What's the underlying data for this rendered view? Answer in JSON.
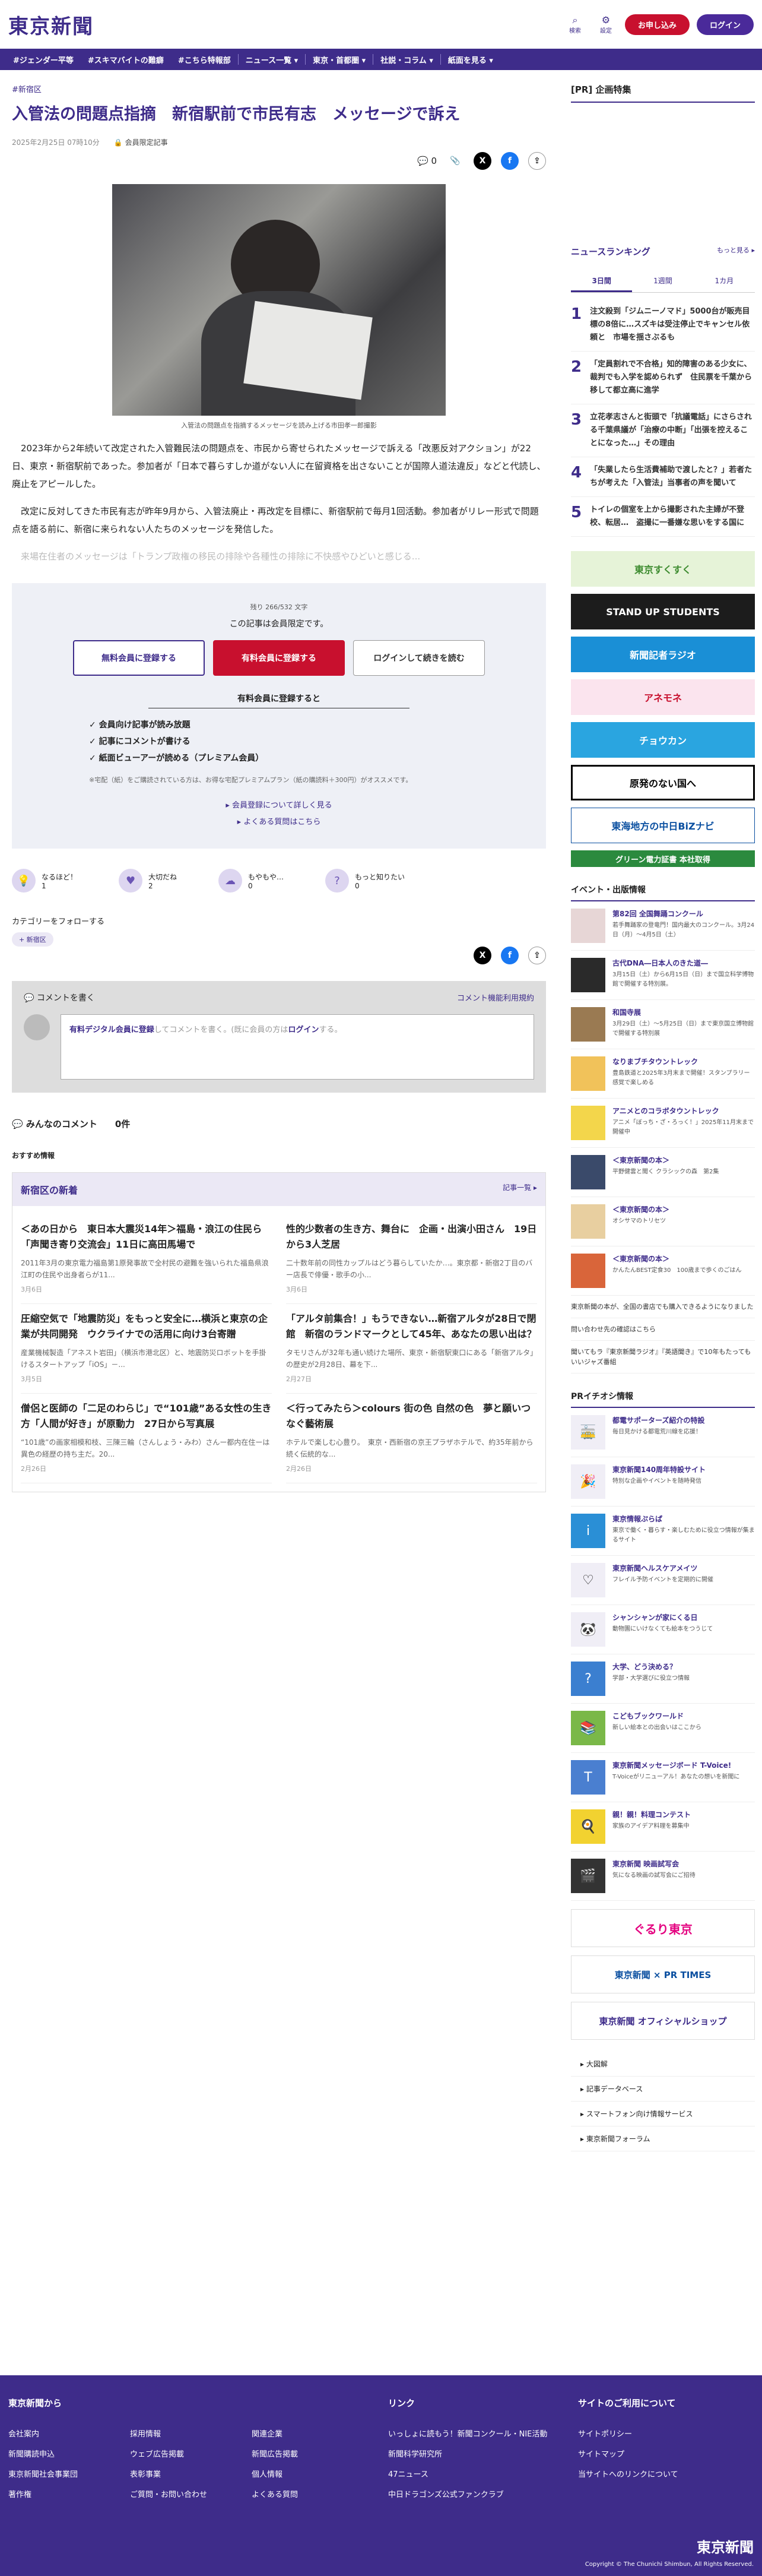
{
  "header": {
    "logo": "東京新聞",
    "search_label": "検索",
    "settings_label": "設定",
    "subscribe": "お申し込み",
    "login": "ログイン"
  },
  "nav": [
    "#ジェンダー平等",
    "#スキマバイトの難癖",
    "#こちら特報部",
    "ニュース一覧 ▾",
    "東京・首都圏 ▾",
    "社説・コラム ▾",
    "紙面を見る ▾"
  ],
  "article": {
    "breadcrumb": "#新宿区",
    "title": "入管法の問題点指摘　新宿駅前で市民有志　メッセージで訴え",
    "date": "2025年2月25日 07時10分",
    "member_badge": "会員限定記事",
    "comment_count": "0",
    "caption": "入管法の問題点を指摘するメッセージを読み上げる市田孝一郎撮影",
    "p1": "2023年から2年続いて改定された入管難民法の問題点を、市民から寄せられたメッセージで訴える「改悪反対アクション」が22日、東京・新宿駅前であった。参加者が「日本で暮らすしか道がない人に在留資格を出さないことが国際人道法違反」などと代読し、廃止をアピールした。",
    "p2": "改定に反対してきた市民有志が昨年9月から、入管法廃止・再改定を目標に、新宿駅前で毎月1回活動。参加者がリレー形式で問題点を語る前に、新宿に来られない人たちのメッセージを発信した。",
    "p3": "来場在住者のメッセージは「トランプ政権の移民の排除や各種性の排除に不快感やひどいと感じる..."
  },
  "paywall": {
    "remaining": "残り 266/532 文字",
    "limited": "この記事は会員限定です。",
    "btn_free": "無料会員に登録する",
    "btn_paid": "有料会員に登録する",
    "btn_login": "ログインして続きを読む",
    "benefits_head": "有料会員に登録すると",
    "benefits": [
      "会員向け記事が読み放題",
      "記事にコメントが書ける",
      "紙面ビューアーが読める（プレミアム会員）"
    ],
    "note": "※宅配（紙）をご購読されている方は、お得な宅配プレミアムプラン（紙の購読料＋300円）がオススメです。",
    "link1": "会員登録について詳しく見る",
    "link2": "よくある質問はこちら"
  },
  "reactions": [
    {
      "label": "なるほど！",
      "count": "1"
    },
    {
      "label": "大切だね",
      "count": "2"
    },
    {
      "label": "もやもや…",
      "count": "0"
    },
    {
      "label": "もっと知りたい",
      "count": "0"
    }
  ],
  "follow": {
    "label": "カテゴリーをフォローする",
    "tag": "+ 新宿区"
  },
  "comments": {
    "head": "コメントを書く",
    "policy": "コメント機能利用規約",
    "placeholder_pre": "有料デジタル会員に登録",
    "placeholder_mid": "してコメントを書く。(既に会員の方は",
    "placeholder_login": "ログイン",
    "placeholder_post": "する。",
    "all": "みんなのコメント　　0件"
  },
  "recommend": "おすすめ情報",
  "news": {
    "head": "新宿区の新着",
    "more": "記事一覧 ▸",
    "items": [
      {
        "t": "＜あの日から　東日本大震災14年＞福島・浪江の住民ら「声聞き寄り交流会」11日に高田馬場で",
        "x": "2011年3月の東京電力福島第1原発事故で全村民の避難を強いられた福島県浪江町の住民や出身者らが11...",
        "d": "3月6日"
      },
      {
        "t": "性的少数者の生き方、舞台に　企画・出演小田さん　19日から3人芝居",
        "x": "二十数年前の同性カップルはどう暮らしていたか…。東京都・新宿2丁目のバー店長で俳優・歌手の小...",
        "d": "3月6日"
      },
      {
        "t": "圧縮空気で「地震防災」をもっと安全に…横浜と東京の企業が共同開発　ウクライナでの活用に向け3台寄贈",
        "x": "産業機械製造「アネスト岩田」（横浜市港北区）と、地震防災ロボットを手掛けるスタートアップ「iOS」－...",
        "d": "3月5日"
      },
      {
        "t": "「アルタ前集合！」もうできない…新宿アルタが28日で閉館　新宿のランドマークとして45年、あなたの思い出は？",
        "x": "タモリさんが32年も通い続けた場所、東京・新宿駅東口にある「新宿アルタ」の歴史が2月28日、幕を下...",
        "d": "2月27日"
      },
      {
        "t": "僧侶と医師の「二足のわらじ」で“101歳”ある女性の生き方「人間が好き」が原動力　27日から写真展",
        "x": "“101歳”の画家相模和枝、三陳三輪（さんしょう・みわ）さんー都内在住ーは異色の経歴の持ち主だ。20...",
        "d": "2月26日"
      },
      {
        "t": "＜行ってみたら＞colours 街の色 自然の色　夢と願いつなぐ藝術展",
        "x": "ホテルで楽しむ心豊り。　東京・西新宿の京王プラザホテルで、約35年前から続く伝統的な...",
        "d": "2月26日"
      }
    ]
  },
  "side": {
    "pr": "[PR] 企画特集",
    "rank_head": "ニュースランキング",
    "rank_more": "もっと見る ▸",
    "tabs": [
      "3日間",
      "1週間",
      "1カ月"
    ],
    "ranking": [
      "注文殺到「ジムニーノマド」5000台が販売目標の8倍に…スズキは受注停止でキャンセル依頼と　市場を揺さぶるも",
      "「定員割れで不合格」知的障害のある少女に、裁判でも入学を認められず　住民票を千葉から移して都立高に進学",
      "立花孝志さんと街頭で「抗議電話」にさらされる千葉県議が「治療の中断」「出張を控えることになった…」その理由",
      "「失業したら生活費補助で渡したと？」若者たちが考えた「入管法」当事者の声を聞いて",
      "トイレの個室を上から撮影された主婦が不登校、転居…　盗撮に一番嫌な思いをする国に"
    ],
    "banners": [
      "東京すくすく",
      "STAND UP STUDENTS",
      "新聞記者ラジオ",
      "アネモネ",
      "チョウカン",
      "原発のない国へ",
      "東海地方の中日BiZナビ",
      "グリーン電力証書 本社取得"
    ],
    "event_head": "イベント・出版情報",
    "events": [
      {
        "t": "第82回 全国舞踊コンクール",
        "x": "若手舞踊家の登竜門！国内最大のコンクール。3月24日（月）〜4月5日（土）"
      },
      {
        "t": "古代DNA―日本人のきた道―",
        "x": "3月15日（土）から6月15日（日）まで国立科学博物館で開催する特別展。"
      },
      {
        "t": "和国寺展",
        "x": "3月29日（土）〜5月25日（日）まで東京国立博物館で開催する特別展"
      },
      {
        "t": "なりまブチタウントレック",
        "x": "豊島鉄道と2025年3月末まで開催！スタンプラリー感覚で楽しめる"
      },
      {
        "t": "アニメとのコラボタウントレック",
        "x": "アニメ「ぼっち・ざ・ろっく！」2025年11月末まで開催中"
      },
      {
        "t": "＜東京新聞の本＞",
        "x": "平野健雲と聞く クラシックの森　第2集"
      },
      {
        "t": "＜東京新聞の本＞",
        "x": "オシサマのトリセツ"
      },
      {
        "t": "＜東京新聞の本＞",
        "x": "かんたんBEST定食30　100歳まで歩くのごはん"
      }
    ],
    "lists": [
      "東京新聞の本が、全国の書店でも購入できるようになりました",
      "問い合わせ先の確認はこちら",
      "聞いてもラ『東京新聞ラジオ』『英語聞き』で10年もたってもいいジャズ番組"
    ],
    "pr_head": "PRイチオシ情報",
    "pr_items": [
      {
        "t": "都電サポーターズ紹介の特設",
        "x": "毎日見かける都電荒川線を応援！"
      },
      {
        "t": "東京新聞140周年特設サイト",
        "x": "特別な企画やイベントを随時発信"
      },
      {
        "t": "東京情報ぷらぱ",
        "x": "東京で働く・暮らす・楽しむために役立つ情報が集まるサイト"
      },
      {
        "t": "東京新聞ヘルスケアメイツ",
        "x": "フレイル予防イベントを定期的に開催"
      },
      {
        "t": "シャンシャンが家にくる日",
        "x": "動物園にいけなくても絵本をつうじて"
      },
      {
        "t": "大学、どう決める？",
        "x": "学部・大学選びに役立つ情報"
      },
      {
        "t": "こどもブックワールド",
        "x": "新しい絵本との出会いはここから"
      },
      {
        "t": "東京新聞メッセージボード T-Voice!",
        "x": "T-Voiceがリニューアル！あなたの想いを新聞に"
      },
      {
        "t": "親！親！料理コンテスト",
        "x": "家族のアイデア料理を募集中"
      },
      {
        "t": "東京新聞 映画試写会",
        "x": "気になる映画の試写会にご招待"
      }
    ],
    "sbanners": [
      "ぐるり東京",
      "東京新聞 × PR TIMES",
      "東京新聞 オフィシャルショップ"
    ],
    "links": [
      "大図解",
      "記事データベース",
      "スマートフォン向け情報サービス",
      "東京新聞フォーラム"
    ]
  },
  "footer": {
    "col1_head": "東京新聞から",
    "col1": [
      [
        "会社案内",
        "新聞購読申込",
        "東京新聞社会事業団",
        "著作権"
      ],
      [
        "採用情報",
        "ウェブ広告掲載",
        "表彰事業",
        "ご質問・お問い合わせ"
      ],
      [
        "関連企業",
        "新聞広告掲載",
        "個人情報",
        "よくある質問"
      ]
    ],
    "col2_head": "リンク",
    "col2": [
      "いっしょに読もう！新聞コンクール・NIE活動",
      "新聞科学研究所",
      "47ニュース",
      "中日ドラゴンズ公式ファンクラブ"
    ],
    "col3_head": "サイトのご利用について",
    "col3": [
      "サイトポリシー",
      "サイトマップ",
      "当サイトへのリンクについて"
    ],
    "logo": "東京新聞",
    "copyright": "Copyright © The Chunichi Shimbun, All Rights Reserved."
  },
  "colors": {
    "brand": "#3e2c8a",
    "accent": "#c8102e"
  }
}
